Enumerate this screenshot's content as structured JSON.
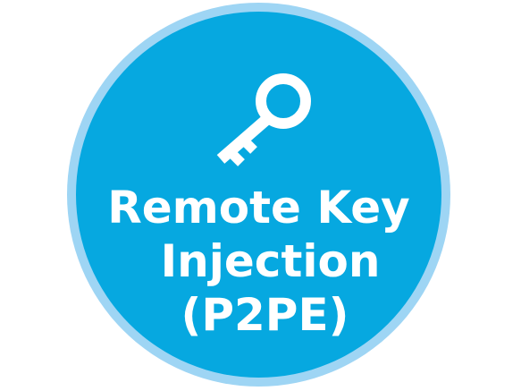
{
  "badge": {
    "title_lines": [
      "Remote Key",
      "Injection",
      "(P2PE)"
    ],
    "icon": "key-icon",
    "colors": {
      "outer_ring": "#9ed5f4",
      "fill": "#06a8e0",
      "text": "#ffffff",
      "icon": "#ffffff"
    }
  }
}
